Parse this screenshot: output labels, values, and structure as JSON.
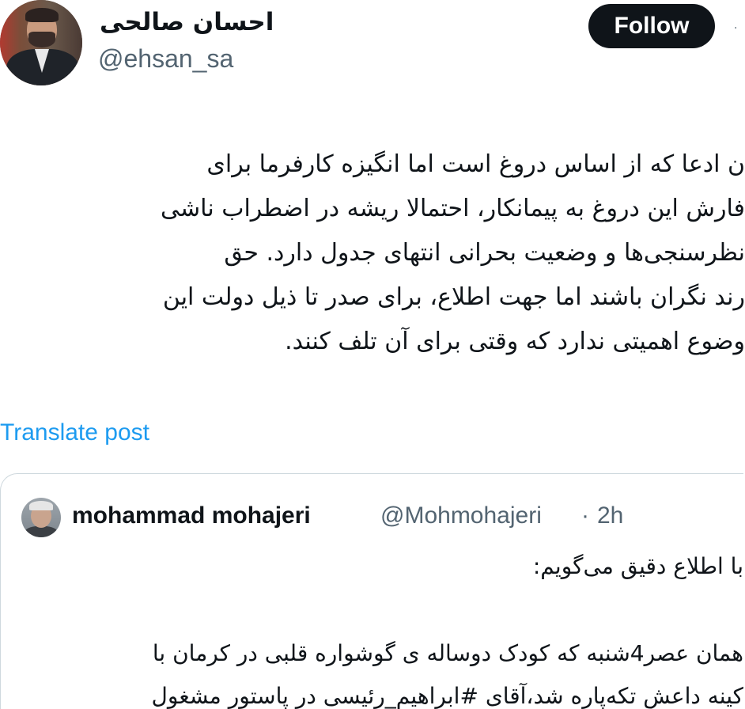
{
  "author": {
    "display_name": "احسان صالحی",
    "handle": "@ehsan_sa",
    "avatar_icon": "profile-photo"
  },
  "actions": {
    "follow_label": "Follow",
    "more_label": "· · ·"
  },
  "tweet": {
    "lines": [
      "ن ادعا که از اساس دروغ است اما انگیزه کارفرما برای",
      "فارش این دروغ به پیمانکار، احتمالا ریشه در اضطراب ناشی",
      "نظرسنجی‌ها و وضعیت بحرانی انتهای جدول دارد. حق",
      "رند نگران باشند اما جهت اطلاع، برای صدر تا ذیل دولت این",
      "وضوع اهمیتی ندارد که وقتی برای آن تلف کنند."
    ],
    "translate_label": "Translate post"
  },
  "quote": {
    "name": "mohammad mohajeri",
    "handle": "@Mohmohajeri",
    "separator": "·",
    "time": "2h",
    "lines": [
      "با اطلاع دقیق می‌گویم:",
      "همان عصر4شنبه که کودک دوساله ی گوشواره قلبی در کرمان با",
      "کینه داعش تکه‌پاره شد،آقای #ابراهیم_رئیسی در پاستور مشغول"
    ]
  },
  "colors": {
    "text": "#0f1419",
    "secondary": "#536471",
    "link": "#1d9bf0",
    "border": "#cfd9de",
    "button_bg": "#0f1419"
  }
}
